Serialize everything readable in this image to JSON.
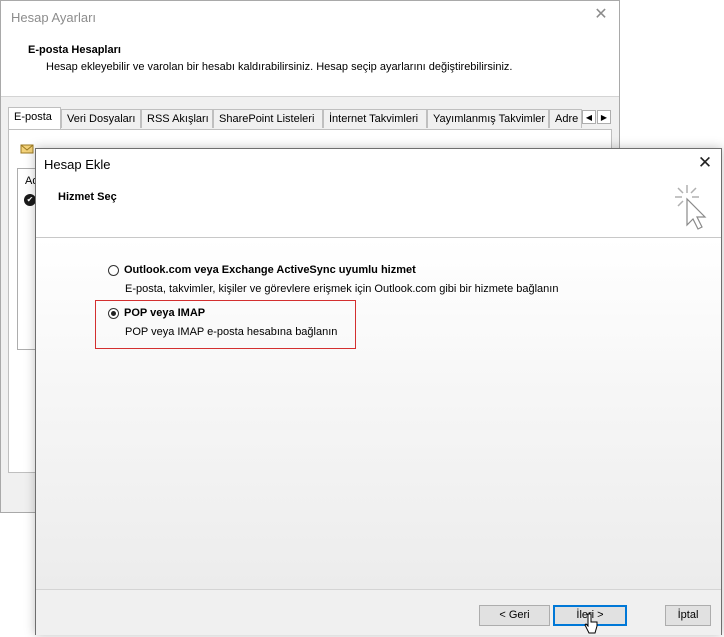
{
  "account_settings_window": {
    "title": "Hesap Ayarları",
    "header_title": "E-posta Hesapları",
    "header_desc": "Hesap ekleyebilir ve varolan bir hesabı kaldırabilirsiniz. Hesap seçip ayarlarını değiştirebilirsiniz.",
    "tabs": [
      {
        "label": "E-posta",
        "active": true
      },
      {
        "label": "Veri Dosyaları",
        "active": false
      },
      {
        "label": "RSS Akışları",
        "active": false
      },
      {
        "label": "SharePoint Listeleri",
        "active": false
      },
      {
        "label": "İnternet Takvimleri",
        "active": false
      },
      {
        "label": "Yayımlanmış Takvimler",
        "active": false
      },
      {
        "label": "Adre",
        "active": false
      }
    ],
    "list_partial_label": "Ad"
  },
  "add_account_dialog": {
    "title": "Hesap Ekle",
    "header_title": "Hizmet Seç",
    "options": [
      {
        "title": "Outlook.com veya Exchange ActiveSync uyumlu hizmet",
        "description": "E-posta, takvimler, kişiler ve görevlere erişmek için Outlook.com gibi bir hizmete bağlanın",
        "selected": false
      },
      {
        "title": "POP veya IMAP",
        "description": "POP veya IMAP e-posta hesabına bağlanın",
        "selected": true
      }
    ],
    "buttons": {
      "back": "< Geri",
      "next": "İleri >",
      "cancel": "İptal"
    }
  },
  "colors": {
    "highlight": "#d32f2f",
    "focus": "#0078d7"
  }
}
